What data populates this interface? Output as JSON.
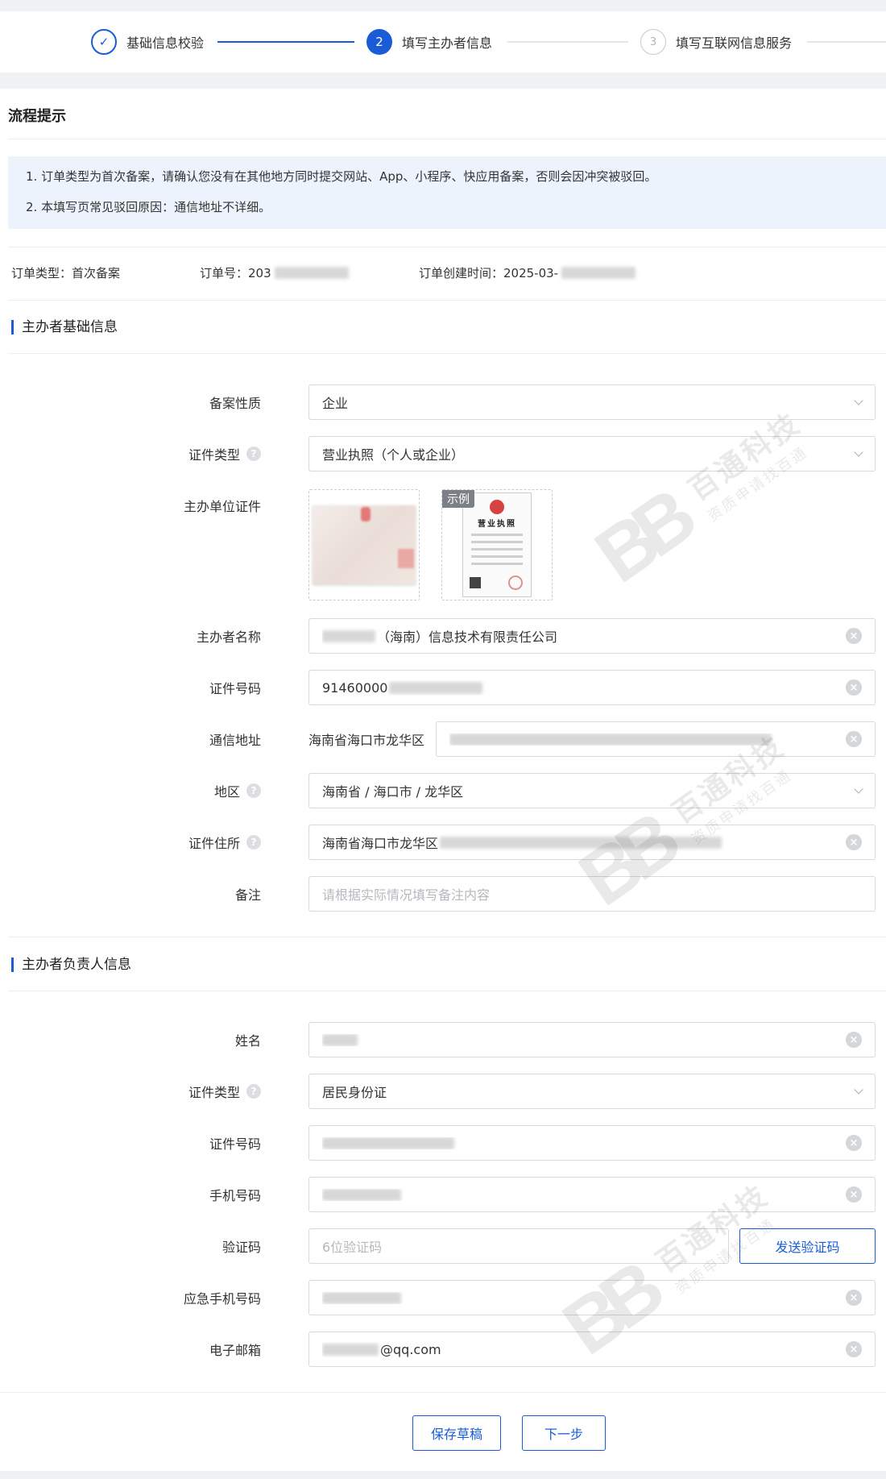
{
  "stepper": {
    "steps": [
      {
        "number": "✓",
        "label": "基础信息校验",
        "state": "done"
      },
      {
        "number": "2",
        "label": "填写主办者信息",
        "state": "active"
      },
      {
        "number": "3",
        "label": "填写互联网信息服务",
        "state": "pending"
      }
    ]
  },
  "process_tips": {
    "title": "流程提示",
    "notes": [
      "1. 订单类型为首次备案，请确认您没有在其他地方同时提交网站、App、小程序、快应用备案，否则会因冲突被驳回。",
      "2. 本填写页常见驳回原因：通信地址不详细。"
    ]
  },
  "order": {
    "type_label": "订单类型：首次备案",
    "number_label": "订单号：203",
    "created_label": "订单创建时间：2025-03-"
  },
  "organizer_basic": {
    "title": "主办者基础信息",
    "nature": {
      "label": "备案性质",
      "value": "企业"
    },
    "cert_type": {
      "label": "证件类型",
      "value": "营业执照（个人或企业）"
    },
    "org_cert": {
      "label": "主办单位证件",
      "example_tag": "示例",
      "example_title": "营业执照"
    },
    "name": {
      "label": "主办者名称",
      "value": "（海南）信息技术有限责任公司"
    },
    "cert_number": {
      "label": "证件号码",
      "value": "91460000"
    },
    "mail_address": {
      "label": "通信地址",
      "prefix": "海南省海口市龙华区"
    },
    "region": {
      "label": "地区",
      "value": "海南省 / 海口市 / 龙华区"
    },
    "cert_address": {
      "label": "证件住所",
      "value": "海南省海口市龙华区"
    },
    "remark": {
      "label": "备注",
      "placeholder": "请根据实际情况填写备注内容"
    }
  },
  "organizer_person": {
    "title": "主办者负责人信息",
    "name": {
      "label": "姓名"
    },
    "cert_type": {
      "label": "证件类型",
      "value": "居民身份证"
    },
    "cert_number": {
      "label": "证件号码"
    },
    "phone": {
      "label": "手机号码"
    },
    "code": {
      "label": "验证码",
      "placeholder": "6位验证码",
      "button": "发送验证码"
    },
    "emergency_phone": {
      "label": "应急手机号码"
    },
    "email": {
      "label": "电子邮箱",
      "suffix": "@qq.com"
    }
  },
  "actions": {
    "save_draft": "保存草稿",
    "next": "下一步"
  },
  "watermark": {
    "logo": "BB",
    "title": "百通科技",
    "subtitle": "资质申请找百通"
  },
  "colors": {
    "accent": "#1a5cd7",
    "notice_bg": "#edf3fd"
  }
}
